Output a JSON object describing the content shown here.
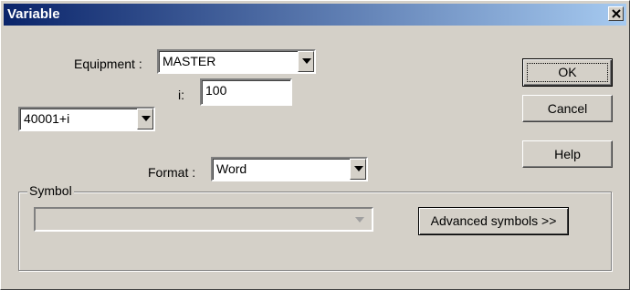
{
  "window": {
    "title": "Variable"
  },
  "equipment": {
    "label": "Equipment :",
    "value": "MASTER"
  },
  "index": {
    "label": "i:",
    "value": "100"
  },
  "address": {
    "value": "40001+i"
  },
  "format": {
    "label": "Format :",
    "value": "Word"
  },
  "buttons": {
    "ok": "OK",
    "cancel": "Cancel",
    "help": "Help"
  },
  "symbol": {
    "group_label": "Symbol",
    "value": "",
    "advanced_label": "Advanced symbols >>"
  },
  "icons": {
    "close": "close-icon",
    "dropdown": "chevron-down-icon"
  }
}
